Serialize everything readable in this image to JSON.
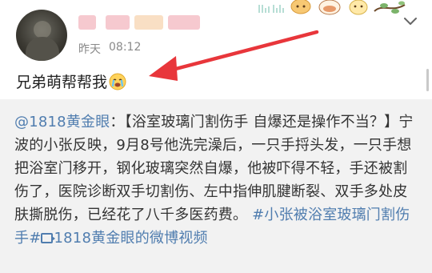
{
  "post": {
    "username": "(redacted)",
    "timestamp_day": "昨天",
    "timestamp_time": "08:12",
    "text": "兄弟萌帮帮我",
    "text_emoji": "crying-face-icon"
  },
  "repost": {
    "mention": "@1818黄金眼",
    "colon": "：",
    "body": "【浴室玻璃门割伤手 自爆还是操作不当？】宁波的小张反映，9月8号他洗完澡后，一只手捋头发，一只手想把浴室门移开，钢化玻璃突然自爆，他被吓得不轻，手还被割伤了，医院诊断双手切割伤、左中指伸肌腱断裂、双手多处皮肤撕脱伤，已经花了八千多医药费。",
    "hashtag": "#小张被浴室玻璃门割伤手#",
    "video_link": "1818黄金眼的微博视频"
  },
  "colors": {
    "link_blue": "#507daf",
    "annotation_red": "#e8363b",
    "repost_bg": "#f2f2f2",
    "timestamp_gray": "#8a8a8a",
    "username_blur_pink": "#f6c9cf",
    "username_blur_orange": "#f9dfc4"
  },
  "icons": {
    "dropdown": "chevron-down-icon",
    "video": "video-icon",
    "decoration": "cute-characters-decoration"
  }
}
